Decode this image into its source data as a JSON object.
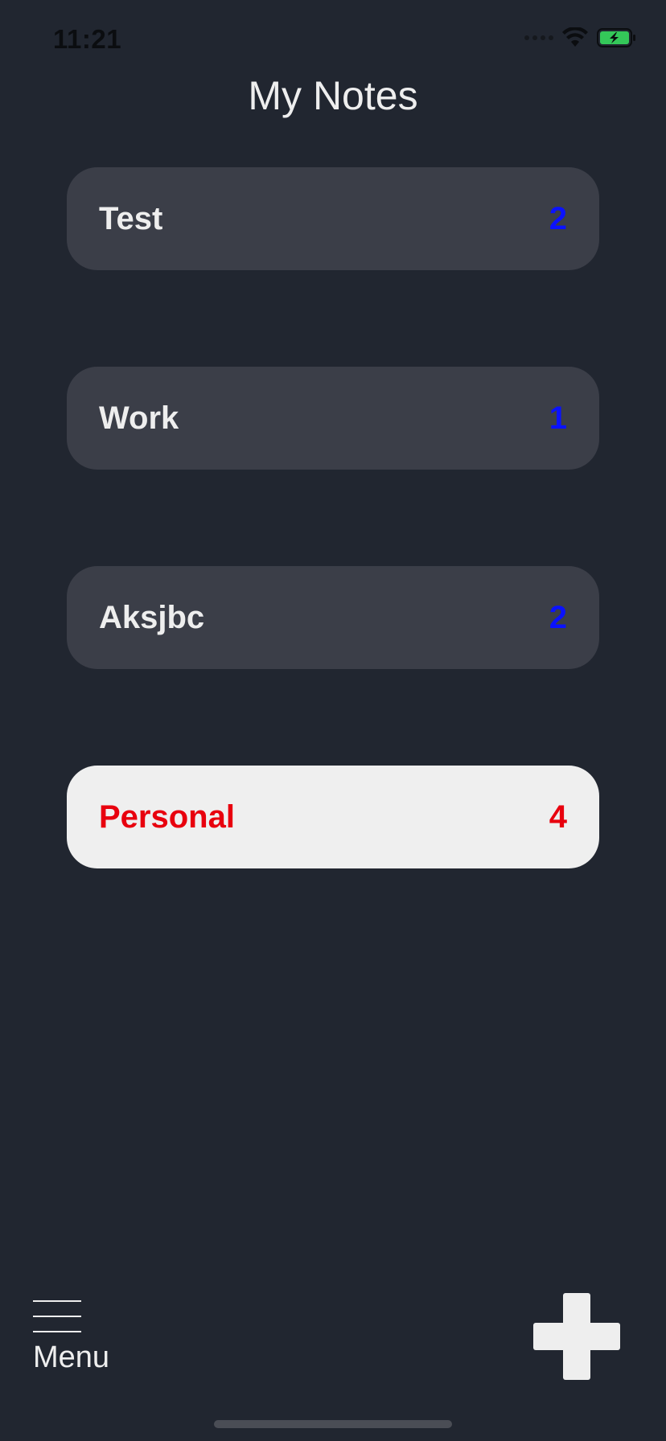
{
  "status_bar": {
    "time": "11:21"
  },
  "header": {
    "title": "My Notes"
  },
  "folders": [
    {
      "name": "Test",
      "count": "2",
      "selected": false
    },
    {
      "name": "Work",
      "count": "1",
      "selected": false
    },
    {
      "name": "Aksjbc",
      "count": "2",
      "selected": false
    },
    {
      "name": "Personal",
      "count": "4",
      "selected": true
    }
  ],
  "bottom_bar": {
    "menu_label": "Menu",
    "menu_icon": "hamburger-menu-icon",
    "add_icon": "plus-icon"
  },
  "colors": {
    "background": "#212630",
    "card": "#3b3e48",
    "card_selected": "#efefef",
    "count_accent": "#0a12ff",
    "selected_accent": "#e8000e",
    "battery": "#34c759"
  }
}
